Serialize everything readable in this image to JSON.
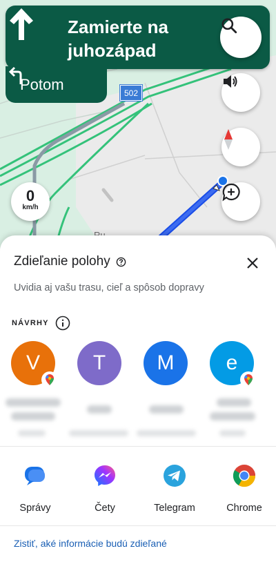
{
  "navigation": {
    "instruction": "Zamierte na juhozápad",
    "then_label": "Potom",
    "road_number": "502"
  },
  "speed": {
    "value": "0",
    "unit": "km/h"
  },
  "map": {
    "street_fragment": "Ru"
  },
  "share_sheet": {
    "title": "Zdieľanie polohy",
    "subtitle": "Uvidia aj vašu trasu, cieľ a spôsob dopravy",
    "suggestions_label": "NÁVRHY",
    "contacts": [
      {
        "initial": "V",
        "color": "#e8710a"
      },
      {
        "initial": "T",
        "color": "#7e6bc9"
      },
      {
        "initial": "M",
        "color": "#1a73e8"
      },
      {
        "initial": "e",
        "color": "#039be5"
      }
    ],
    "apps": [
      {
        "label": "Správy"
      },
      {
        "label": "Čety"
      },
      {
        "label": "Telegram"
      },
      {
        "label": "Chrome"
      }
    ],
    "info_link": "Zistiť, aké informácie budú zdieľané"
  },
  "colors": {
    "nav_green": "#0b5a45",
    "route_blue": "#1a4de8",
    "link_blue": "#1a5fb4"
  }
}
